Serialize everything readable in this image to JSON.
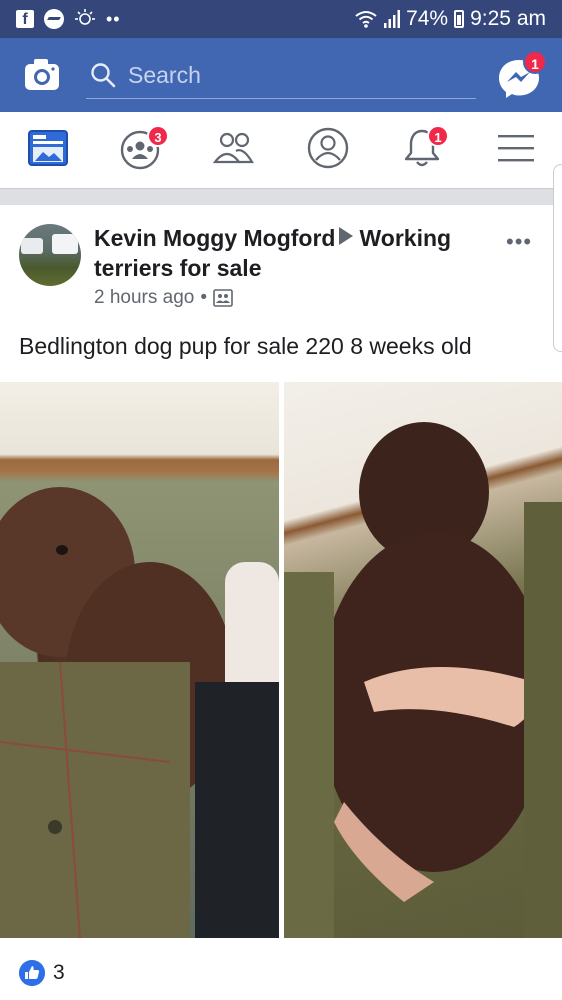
{
  "status_bar": {
    "battery": "74%",
    "time": "9:25 am"
  },
  "header": {
    "search_placeholder": "Search",
    "messenger_badge": "1"
  },
  "nav": {
    "tabs": [
      {
        "name": "news-feed",
        "badge": ""
      },
      {
        "name": "groups",
        "badge": "3"
      },
      {
        "name": "friends",
        "badge": ""
      },
      {
        "name": "profile",
        "badge": ""
      },
      {
        "name": "notifications",
        "badge": "1"
      },
      {
        "name": "menu",
        "badge": ""
      }
    ],
    "groups_badge": "3",
    "notifications_badge": "1"
  },
  "post": {
    "author": "Kevin Moggy Mogford",
    "group": "Working terriers for sale",
    "time": "2 hours ago",
    "separator": "•",
    "text": "Bedlington dog pup for sale 220 8 weeks old",
    "like_count": "3"
  },
  "colors": {
    "status_bar": "#34467a",
    "header": "#4267b2",
    "badge": "#f02849",
    "like": "#2e6fe8"
  }
}
